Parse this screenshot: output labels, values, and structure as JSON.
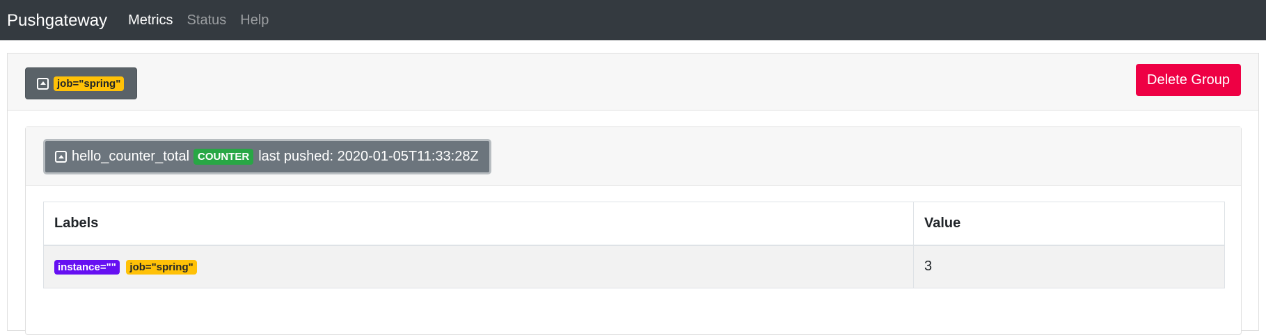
{
  "app": {
    "brand": "Pushgateway"
  },
  "nav": {
    "items": [
      {
        "label": "Metrics",
        "active": true
      },
      {
        "label": "Status",
        "active": false
      },
      {
        "label": "Help",
        "active": false
      }
    ]
  },
  "group": {
    "label": "job=\"spring\"",
    "icon": "collapse-up-icon",
    "delete_label": "Delete Group"
  },
  "metric": {
    "name": "hello_counter_total",
    "type_badge": "COUNTER",
    "last_pushed": "last pushed: 2020-01-05T11:33:28Z",
    "table": {
      "headers": [
        "Labels",
        "Value"
      ],
      "rows": [
        {
          "labels": [
            "instance=\"\"",
            "job=\"spring\""
          ],
          "value": "3"
        }
      ]
    }
  },
  "colors": {
    "navbar": "#343a40",
    "delete": "#ee0044",
    "job_badge": "#ffc107",
    "instance_badge": "#6610f2",
    "counter_badge": "#28a745"
  }
}
